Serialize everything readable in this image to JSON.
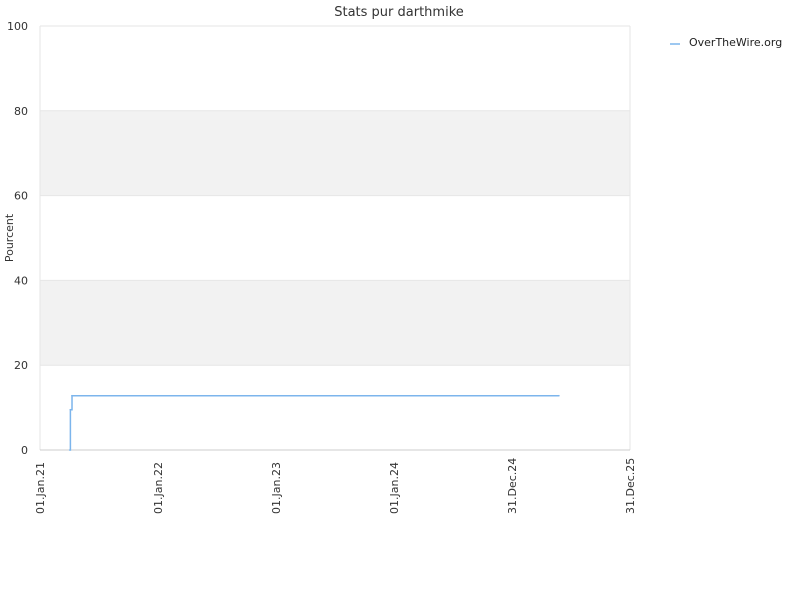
{
  "chart_data": {
    "type": "line",
    "title": "Stats pur darthmike",
    "ylabel": "Pourcent",
    "xlabel": "",
    "ylim": [
      0,
      100
    ],
    "yticks": [
      "0",
      "20",
      "40",
      "60",
      "80",
      "100"
    ],
    "x_range": [
      "2021-01-01",
      "2025-12-31"
    ],
    "xticks": [
      {
        "date": "2021-01-01",
        "label": "01.Jan.21"
      },
      {
        "date": "2022-01-01",
        "label": "01.Jan.22"
      },
      {
        "date": "2023-01-01",
        "label": "01.Jan.23"
      },
      {
        "date": "2024-01-01",
        "label": "01.Jan.24"
      },
      {
        "date": "2024-12-31",
        "label": "31.Dec.24"
      },
      {
        "date": "2025-12-31",
        "label": "31.Dec.25"
      }
    ],
    "grid": true,
    "alternating_bands": true,
    "legend_position": "top-right",
    "series": [
      {
        "name": "OverTheWire.org",
        "color": "#7cb5ec",
        "step": true,
        "points": [
          {
            "x": "2021-04-03",
            "y": 0
          },
          {
            "x": "2021-04-05",
            "y": 9.5
          },
          {
            "x": "2021-04-10",
            "y": 12.8
          },
          {
            "x": "2025-05-25",
            "y": 12.8
          }
        ]
      }
    ]
  },
  "colors": {
    "grid": "#e6e6e6",
    "band": "#f2f2f2",
    "axis": "#cccccc"
  }
}
